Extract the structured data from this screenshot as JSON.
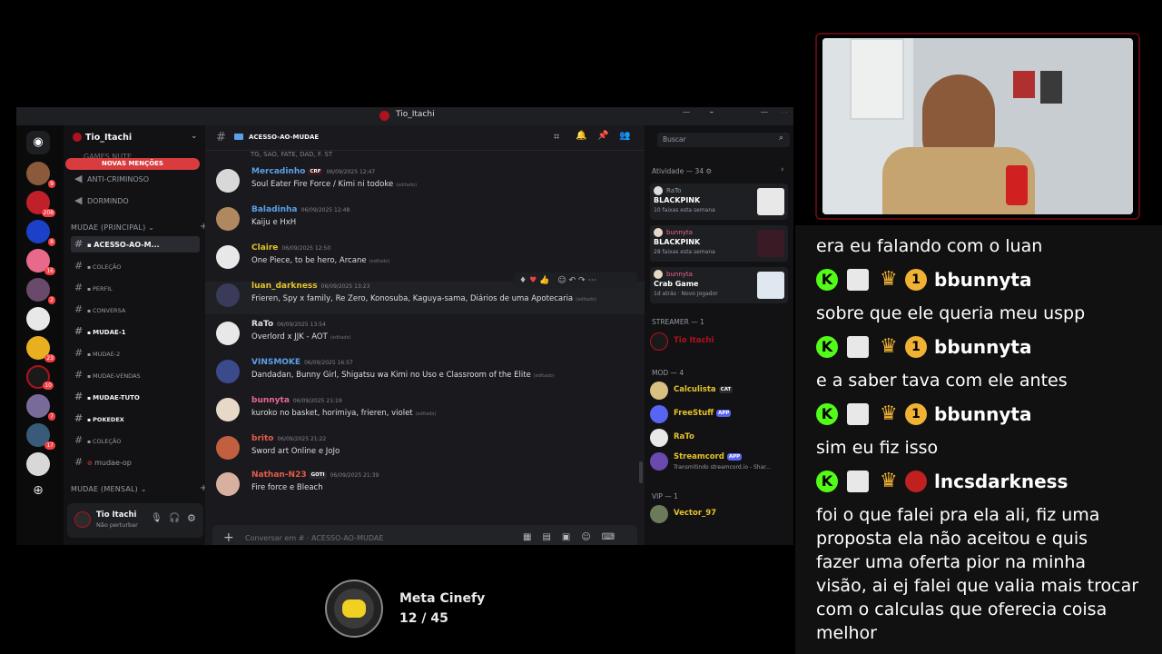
{
  "window": {
    "title": "Tio_Itachi"
  },
  "server": {
    "name": "Tio_Itachi",
    "mentions_banner": "NOVAS MENÇÕES"
  },
  "servers": [
    {
      "badge": "9"
    },
    {
      "badge": "208"
    },
    {
      "badge": "8"
    },
    {
      "badge": "16"
    },
    {
      "badge": "2"
    },
    {
      "badge": ""
    },
    {
      "badge": "23"
    },
    {
      "badge": "10"
    },
    {
      "badge": "7"
    },
    {
      "badge": "17"
    },
    {
      "badge": ""
    }
  ],
  "voice_channels": [
    "GAMES NUTE",
    "ANTI-CRIMINOSO",
    "DORMINDO"
  ],
  "category_main": "MUDAE (PRINCIPAL)",
  "category_monthly": "MUDAE (MENSAL)",
  "text_channels": [
    "ACESSO-AO-M...",
    "COLEÇÃO",
    "PERFIL",
    "CONVERSA",
    "MUDAE-1",
    "MUDAE-2",
    "MUDAE-VENDAS",
    "MUDAE-TUTO",
    "POKEDEX",
    "COLEÇÃO",
    "mudae-op"
  ],
  "user": {
    "name": "Tio Itachi",
    "status": "Não perturbar"
  },
  "channel_header": {
    "name": "ACESSO-AO-MUDAE",
    "search_placeholder": "Buscar"
  },
  "top_partial": "TG, SAO, FATE, DAD, F. ST",
  "messages": [
    {
      "name": "Mercadinho",
      "tag": "CRF",
      "time": "06/09/2025 12:47",
      "text": "Soul Eater Fire Force / Kimi ni todoke",
      "edited": "(editado)",
      "color": "#5aa0e8"
    },
    {
      "name": "Baladinha",
      "tag": "",
      "time": "06/09/2025 12:48",
      "text": "Kaiju e HxH",
      "edited": "",
      "color": "#5aa0e8"
    },
    {
      "name": "Claire",
      "tag": "",
      "time": "06/09/2025 12:50",
      "text": "One Piece, to be hero, Arcane",
      "edited": "(editado)",
      "color": "#e6c229"
    },
    {
      "name": "luan_darkness",
      "tag": "",
      "time": "06/09/2025 13:23",
      "text": "Frieren, Spy x family, Re Zero, Konosuba, Kaguya-sama, Diários de uma Apotecaria",
      "edited": "(editado)",
      "color": "#e6c229"
    },
    {
      "name": "RaTo",
      "tag": "",
      "time": "06/09/2025 13:54",
      "text": "Overlord x JJK - AOT",
      "edited": "(editado)",
      "color": "#dbdee1"
    },
    {
      "name": "VINSMOKE",
      "tag": "",
      "time": "06/09/2025 16:57",
      "text": "Dandadan, Bunny Girl, Shigatsu wa Kimi no Uso e Classroom of the Elite",
      "edited": "(editado)",
      "color": "#5aa0e8"
    },
    {
      "name": "bunnyta",
      "tag": "",
      "time": "06/09/2025 21:19",
      "text": "kuroko no basket, horimiya, frieren, violet",
      "edited": "(editado)",
      "color": "#e8688f"
    },
    {
      "name": "brito",
      "tag": "",
      "time": "06/09/2025 21:22",
      "text": "Sword art Online e JoJo",
      "edited": "",
      "color": "#e85a4a"
    },
    {
      "name": "Nathan-N23",
      "tag": "GOTI",
      "time": "06/09/2025 21:39",
      "text": "Fire force e Bleach",
      "edited": "",
      "color": "#e85a4a"
    }
  ],
  "composer": {
    "placeholder": "Conversar em #  · ACESSO-AO-MUDAE"
  },
  "members": {
    "activity_header": "Atividade — 34",
    "activities": [
      {
        "user": "RaTo",
        "game": "BLACKPINK",
        "sub": "10 faixas esta semana",
        "icon_color": "#e8e8e8"
      },
      {
        "user": "bunnyta",
        "game": "BLACKPINK",
        "sub": "28 faixas esta semana",
        "icon_color": "#3a1a24"
      },
      {
        "user": "bunnyta",
        "game": "Crab Game",
        "sub": "1d atrás · Novo Jogador",
        "icon_color": "#dfe8f0"
      }
    ],
    "streamer_header": "STREAMER — 1",
    "streamer": "Tio Itachi",
    "mod_header": "MOD — 4",
    "mods": [
      {
        "name": "Calculista",
        "tag": "CAT",
        "color": "#e6c229"
      },
      {
        "name": "FreeStuff",
        "tag": "APP",
        "color": "#e6c229"
      },
      {
        "name": "RaTo",
        "tag": "",
        "color": "#e6c229"
      },
      {
        "name": "Streamcord",
        "tag": "APP",
        "color": "#e6c229",
        "sub": "Transmitindo streamcord.io - Shar..."
      }
    ],
    "vip_header": "VIP — 1",
    "vip": "Vector_97"
  },
  "chat_overlay": [
    {
      "type": "text",
      "text": "era eu falando com o luan"
    },
    {
      "type": "user",
      "name": "bbunnyta"
    },
    {
      "type": "text",
      "text": "sobre que ele queria meu uspp"
    },
    {
      "type": "user",
      "name": "bbunnyta"
    },
    {
      "type": "text",
      "text": "e a saber tava com ele antes"
    },
    {
      "type": "user",
      "name": "bbunnyta"
    },
    {
      "type": "text",
      "text": "sim eu fiz isso"
    },
    {
      "type": "user",
      "name": "lncsdarkness"
    },
    {
      "type": "text",
      "text": "foi o que falei pra ela ali, fiz uma"
    },
    {
      "type": "text",
      "text": "proposta ela não aceitou e quis"
    },
    {
      "type": "text",
      "text": "fazer uma oferta pior na minha"
    },
    {
      "type": "text",
      "text": "visão, ai ej falei que valia mais trocar"
    },
    {
      "type": "text",
      "text": "com o calculas que oferecia coisa"
    },
    {
      "type": "text",
      "text": "melhor"
    }
  ],
  "goal": {
    "title": "Meta Cinefy",
    "progress": "12 / 45"
  },
  "colors": {
    "accent": "#f23f43",
    "bg": "#111214"
  }
}
